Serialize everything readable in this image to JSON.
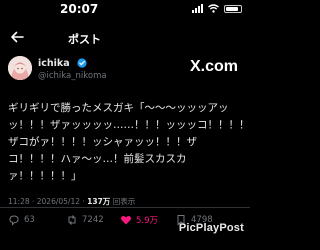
{
  "status_bar": {
    "time": "20:07"
  },
  "header": {
    "title": "ポスト"
  },
  "author": {
    "display_name": "ichika",
    "handle": "@ichika_nikoma"
  },
  "brand": {
    "logo_text": "X.com"
  },
  "post": {
    "lines": [
      "ギリギリで勝ったメスガキ「〜〜〜ッッッアッ",
      "ッ！！！ザァッッッッ……！！！ッッッコ！！！！",
      "ザコがァ！！！！ッシャァッッ！！！ザ",
      "コ！！！！ハァ〜ッ…！前髪スカスカ",
      "ァ！！！！！」"
    ]
  },
  "meta": {
    "timestamp": "11:28 · 2026/05/12 · ",
    "views_count": "137万",
    "views_label": "回表示"
  },
  "actions": {
    "replies": "63",
    "reposts": "7242",
    "likes": "5.9万",
    "bookmarks": "4798"
  },
  "watermark": {
    "text": "PicPlayPost"
  },
  "colors": {
    "background": "#000000",
    "text": "#e7e9ea",
    "muted": "#71767b",
    "like": "#f91880",
    "verified": "#1d9bf0"
  }
}
